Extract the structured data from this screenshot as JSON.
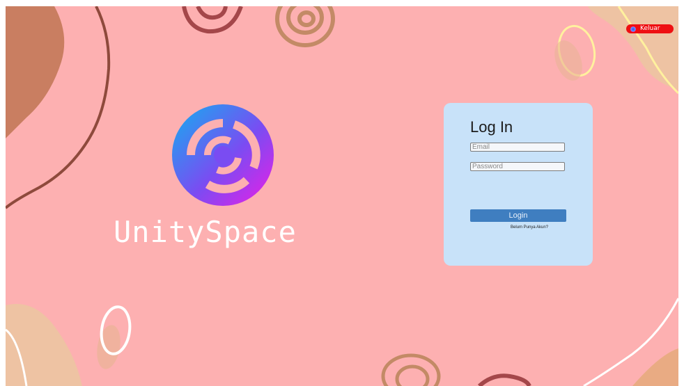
{
  "header": {
    "exit_label": "Keluar",
    "exit_icon": "unityspace-logo-icon"
  },
  "brand": {
    "name": "UnitySpace"
  },
  "login": {
    "title": "Log In",
    "email_placeholder": "Email",
    "password_placeholder": "Password",
    "button_label": "Login",
    "signup_link": "Belum Punya Akun?"
  },
  "colors": {
    "background": "#fdb0b1",
    "card": "#c8e2f9",
    "button": "#3f7ec0",
    "exit_button": "#ee0f12",
    "brand_text": "#ffffff"
  }
}
